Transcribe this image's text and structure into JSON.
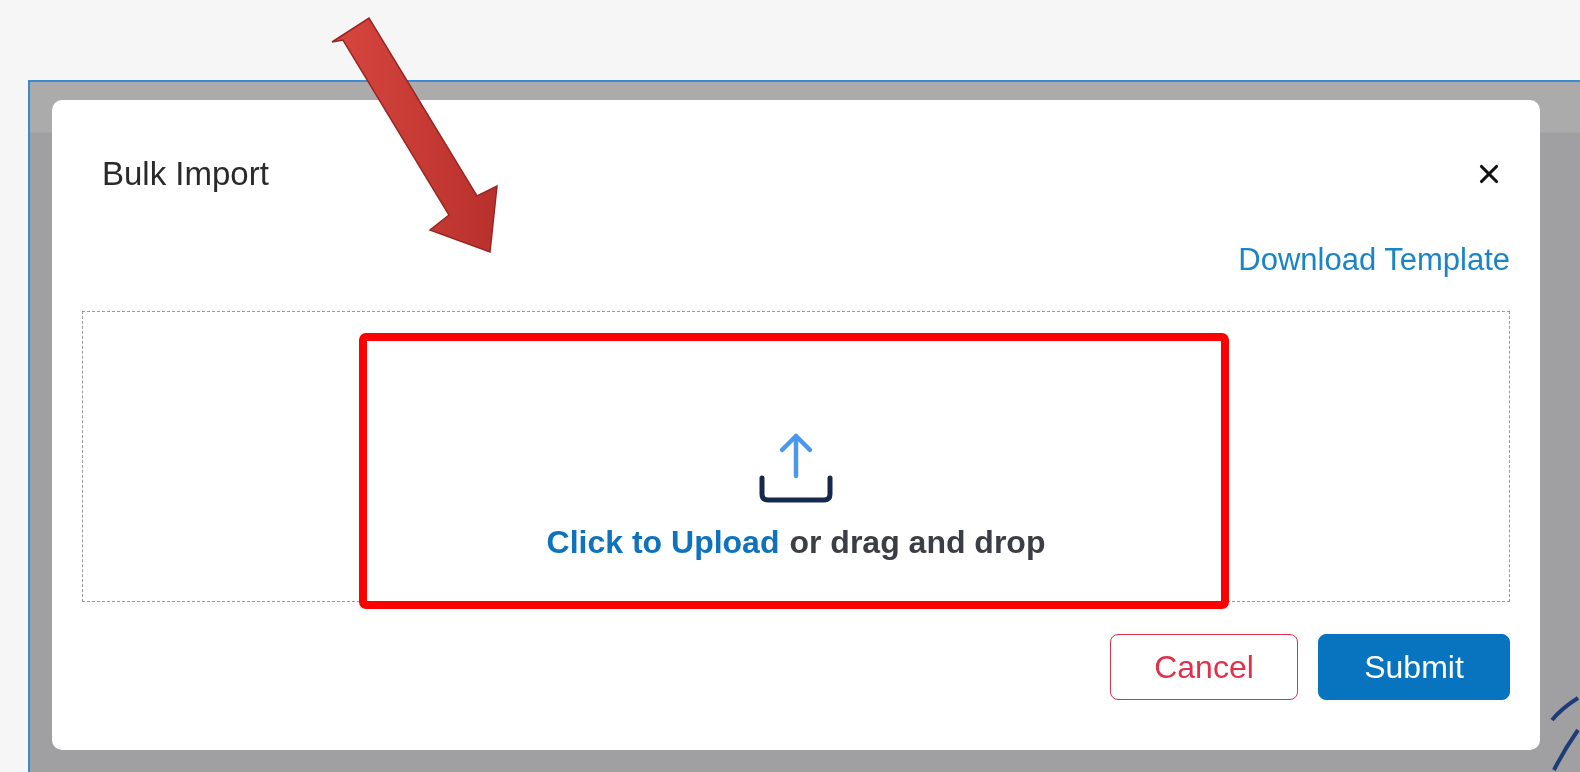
{
  "dialog": {
    "title": "Bulk Import",
    "download_link": "Download Template",
    "upload": {
      "link": "Click to Upload",
      "hint": "or drag and drop"
    },
    "buttons": [
      {
        "label": "Cancel",
        "kind": "secondary"
      },
      {
        "label": "Submit",
        "kind": "primary"
      }
    ]
  }
}
